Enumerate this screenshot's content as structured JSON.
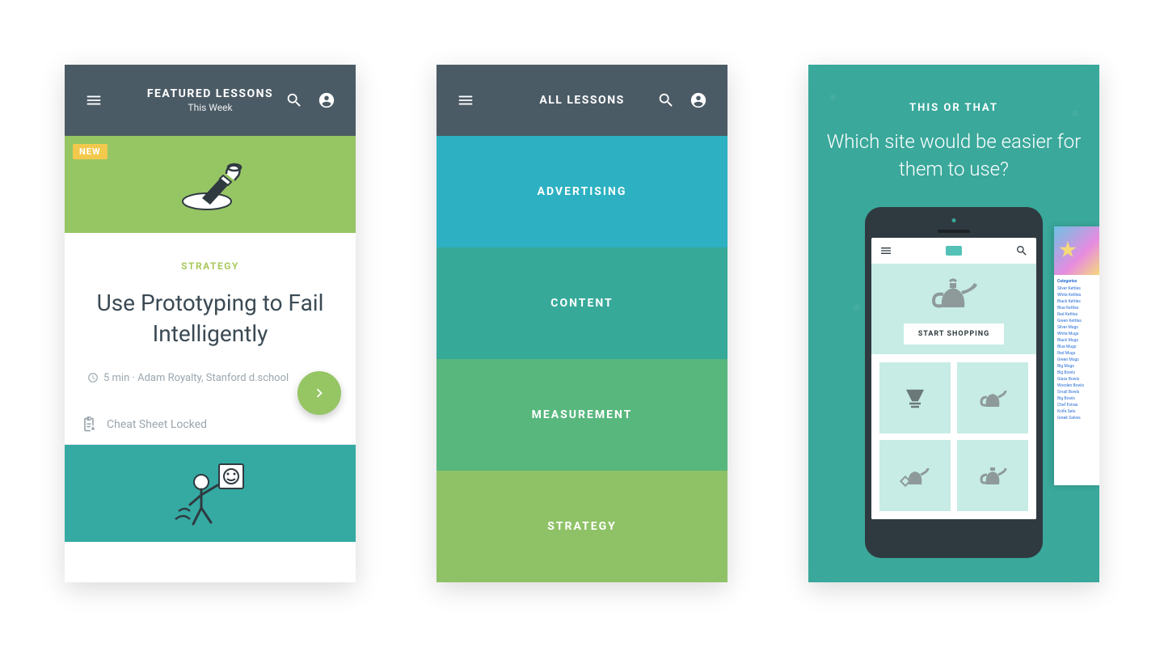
{
  "screen1": {
    "appbar": {
      "title": "FEATURED LESSONS",
      "subtitle": "This Week"
    },
    "card1": {
      "badge": "NEW",
      "category": "STRATEGY",
      "title": "Use Prototyping to Fail Intelligently",
      "meta": "5 min · Adam Royalty, Stanford d.school"
    },
    "cheat_locked": "Cheat Sheet Locked"
  },
  "screen2": {
    "appbar": {
      "title": "ALL LESSONS"
    },
    "categories": [
      {
        "label": "ADVERTISING"
      },
      {
        "label": "CONTENT"
      },
      {
        "label": "MEASUREMENT"
      },
      {
        "label": "STRATEGY"
      }
    ]
  },
  "screen3": {
    "eyebrow": "THIS OR THAT",
    "question": "Which site would be easier for them to use?",
    "phone": {
      "cta": "START SHOPPING"
    },
    "alt_site": {
      "header": "Categories",
      "items": [
        "Silver Kettles",
        "White Kettles",
        "Black Kettles",
        "Blue Kettles",
        "Red Kettles",
        "Green Kettles",
        "Silver Mugs",
        "White Mugs",
        "Black Mugs",
        "Blue Mugs",
        "Red Mugs",
        "Green Mugs",
        "Big Mugs",
        "Big Bowls",
        "Glass Bowls",
        "Wooden Bowls",
        "Small Bowls",
        "Big Bowls",
        "Chef Extras",
        "Knife Sets",
        "Greek Salves"
      ]
    }
  }
}
